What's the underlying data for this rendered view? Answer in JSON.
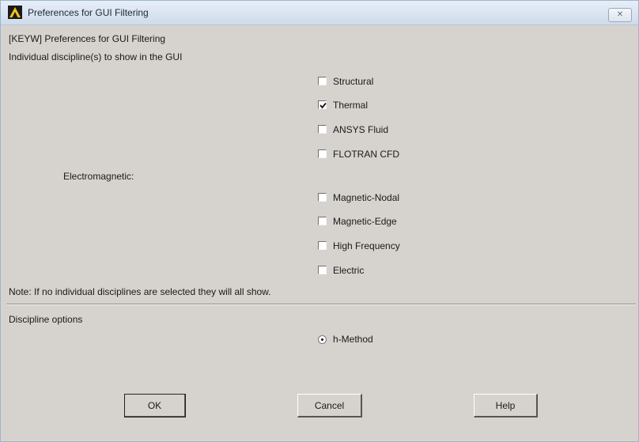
{
  "window": {
    "title": "Preferences for GUI Filtering",
    "close_label": "✕"
  },
  "header": {
    "keyword_title": "[KEYW] Preferences for GUI Filtering",
    "section_label": "Individual discipline(s) to show in the GUI"
  },
  "disciplines": [
    {
      "label": "Structural",
      "checked": false
    },
    {
      "label": "Thermal",
      "checked": true
    },
    {
      "label": "ANSYS Fluid",
      "checked": false
    },
    {
      "label": "FLOTRAN CFD",
      "checked": false
    }
  ],
  "electromagnetic": {
    "label": "Electromagnetic:",
    "items": [
      {
        "label": "Magnetic-Nodal",
        "checked": false
      },
      {
        "label": "Magnetic-Edge",
        "checked": false
      },
      {
        "label": "High Frequency",
        "checked": false
      },
      {
        "label": "Electric",
        "checked": false
      }
    ]
  },
  "note": "Note: If no individual disciplines are selected they will all show.",
  "discipline_options": {
    "label": "Discipline options",
    "method": {
      "label": "h-Method",
      "selected": true
    }
  },
  "buttons": {
    "ok": "OK",
    "cancel": "Cancel",
    "help": "Help"
  }
}
